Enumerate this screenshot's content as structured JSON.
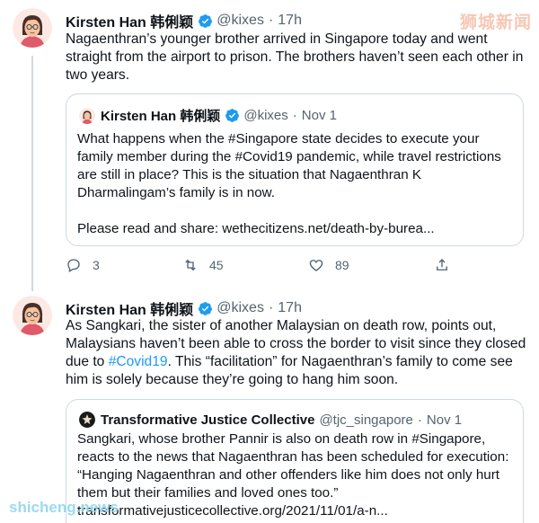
{
  "watermark": {
    "top": "狮城新闻",
    "bottom": "shicheng.news"
  },
  "tweet1": {
    "author_name": "Kirsten Han 韩俐颖",
    "handle": "@kixes",
    "time": "17h",
    "text": "Nagaenthran’s younger brother arrived in Singapore today and went straight from the airport to prison. The brothers haven’t seen each other in two years.",
    "quote": {
      "author_name": "Kirsten Han 韩俐颖",
      "handle": "@kixes",
      "time": "Nov 1",
      "text_pre": "What happens when the ",
      "hashtag1": "#Singapore",
      "text_mid": " state decides to execute your family member during the ",
      "hashtag2": "#Covid19",
      "text_post": " pandemic, while travel restrictions are still in place? This is the situation that Nagaenthran K Dharmalingam’s family is in now.",
      "text_share": "Please read and share: wethecitizens.net/death-by-burea..."
    },
    "actions": {
      "replies": "3",
      "retweets": "45",
      "likes": "89"
    }
  },
  "tweet2": {
    "author_name": "Kirsten Han 韩俐颖",
    "handle": "@kixes",
    "time": "17h",
    "text_pre": "As Sangkari, the sister of another Malaysian on death row, points out, Malaysians haven’t been able to cross the border to visit since they closed due to ",
    "hashtag": "#Covid19",
    "text_post": ". This “facilitation” for Nagaenthran’s family to come see him is solely because they’re going to hang him soon.",
    "quote": {
      "author_name": "Transformative Justice Collective",
      "handle": "@tjc_singapore",
      "time": "Nov 1",
      "text_pre": "Sangkari, whose brother Pannir is also on death row in ",
      "hashtag": "#Singapore",
      "text_post": ", reacts to the news that Nagaenthran has been scheduled for execution: “Hanging Nagaenthran and other offenders like him does not only hurt them but their families and loved ones too.”",
      "link": "transformativejusticecollective.org/2021/11/01/a-n..."
    }
  },
  "colors": {
    "accent": "#1d9bf0",
    "text": "#0f1419",
    "muted": "#536471",
    "border": "#cfd9de"
  }
}
